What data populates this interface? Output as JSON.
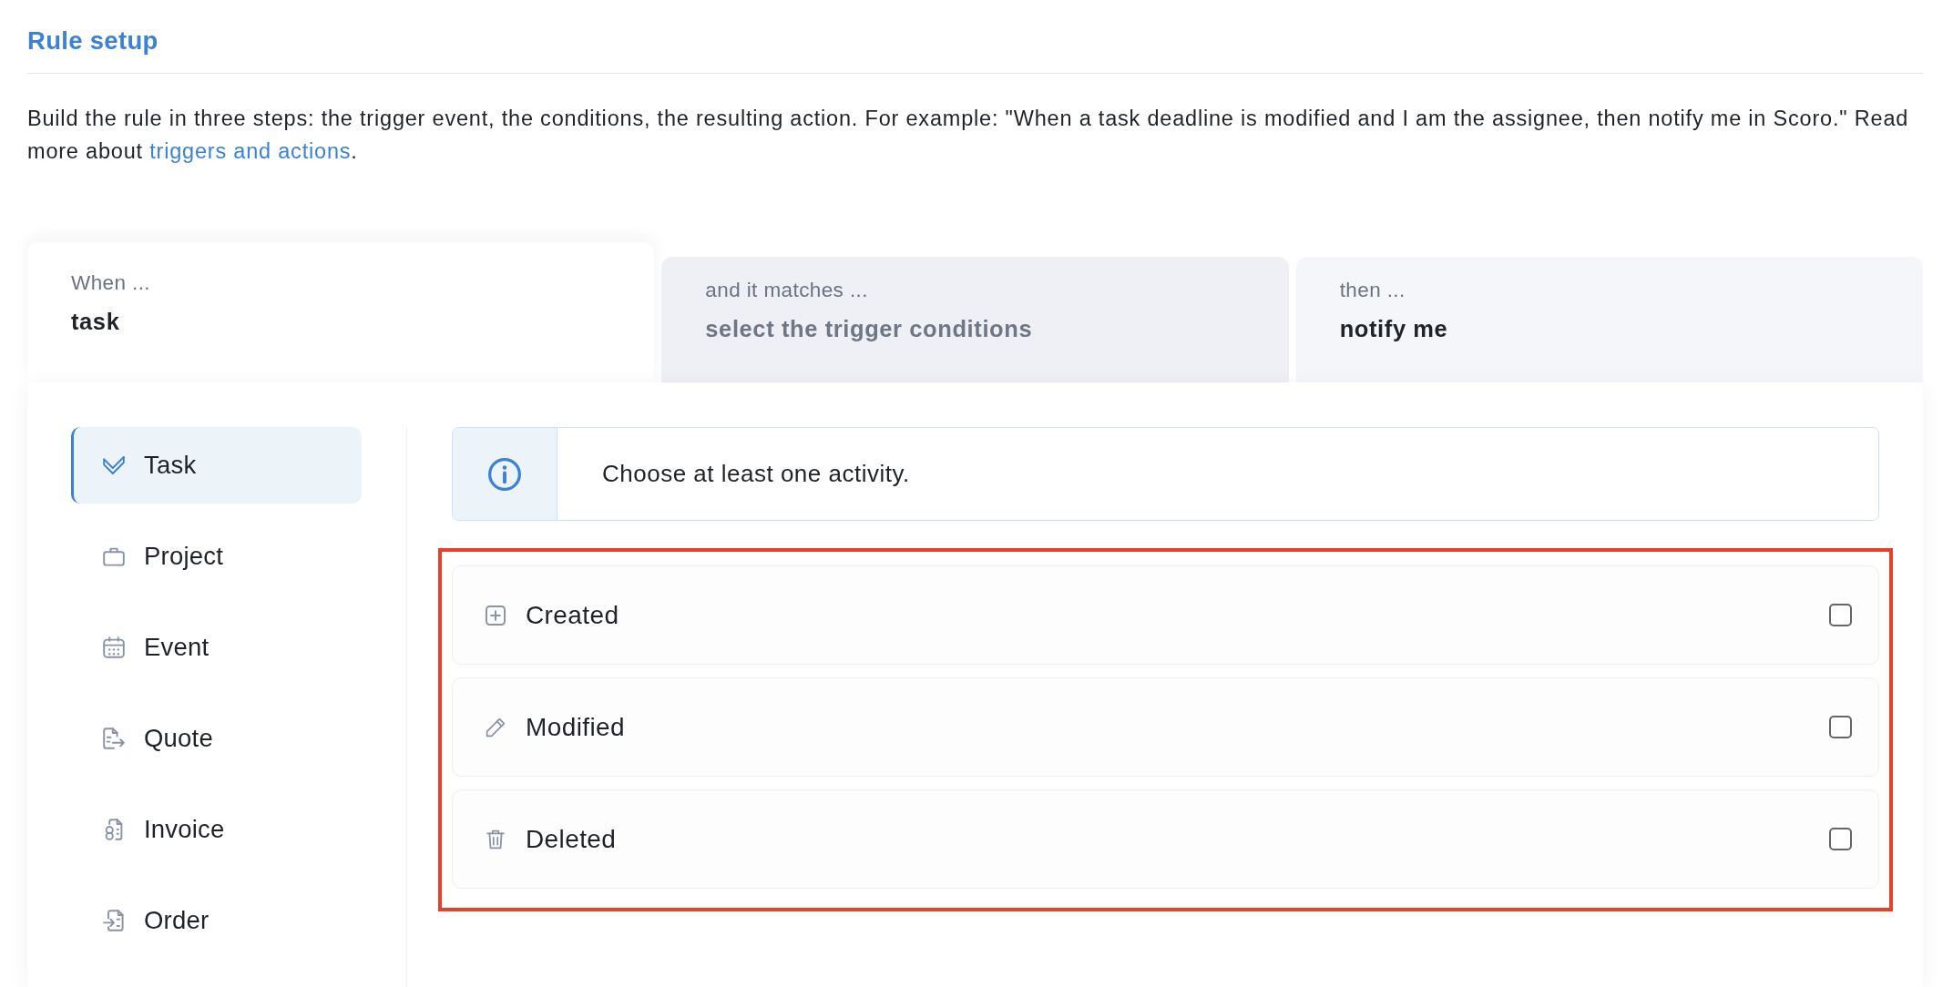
{
  "header": {
    "title": "Rule setup"
  },
  "description": {
    "text": "Build the rule in three steps: the trigger event, the conditions, the resulting action. For example: \"When a task deadline is modified and I am the assignee, then notify me in Scoro.\" Read more about ",
    "link": "triggers and actions",
    "after": "."
  },
  "steps": [
    {
      "label": "When ...",
      "value": "task",
      "selected": true,
      "filled": true
    },
    {
      "label": "and it matches ...",
      "value": "select the trigger conditions",
      "selected": false,
      "filled": false
    },
    {
      "label": "then ...",
      "value": "notify me",
      "selected": false,
      "filled": true
    }
  ],
  "sidebar": {
    "items": [
      {
        "label": "Task",
        "selected": true
      },
      {
        "label": "Project",
        "selected": false
      },
      {
        "label": "Event",
        "selected": false
      },
      {
        "label": "Quote",
        "selected": false
      },
      {
        "label": "Invoice",
        "selected": false
      },
      {
        "label": "Order",
        "selected": false
      }
    ]
  },
  "notice": {
    "text": "Choose at least one activity."
  },
  "activities": {
    "highlighted": true,
    "items": [
      {
        "label": "Created",
        "checked": false
      },
      {
        "label": "Modified",
        "checked": false
      },
      {
        "label": "Deleted",
        "checked": false
      }
    ]
  }
}
